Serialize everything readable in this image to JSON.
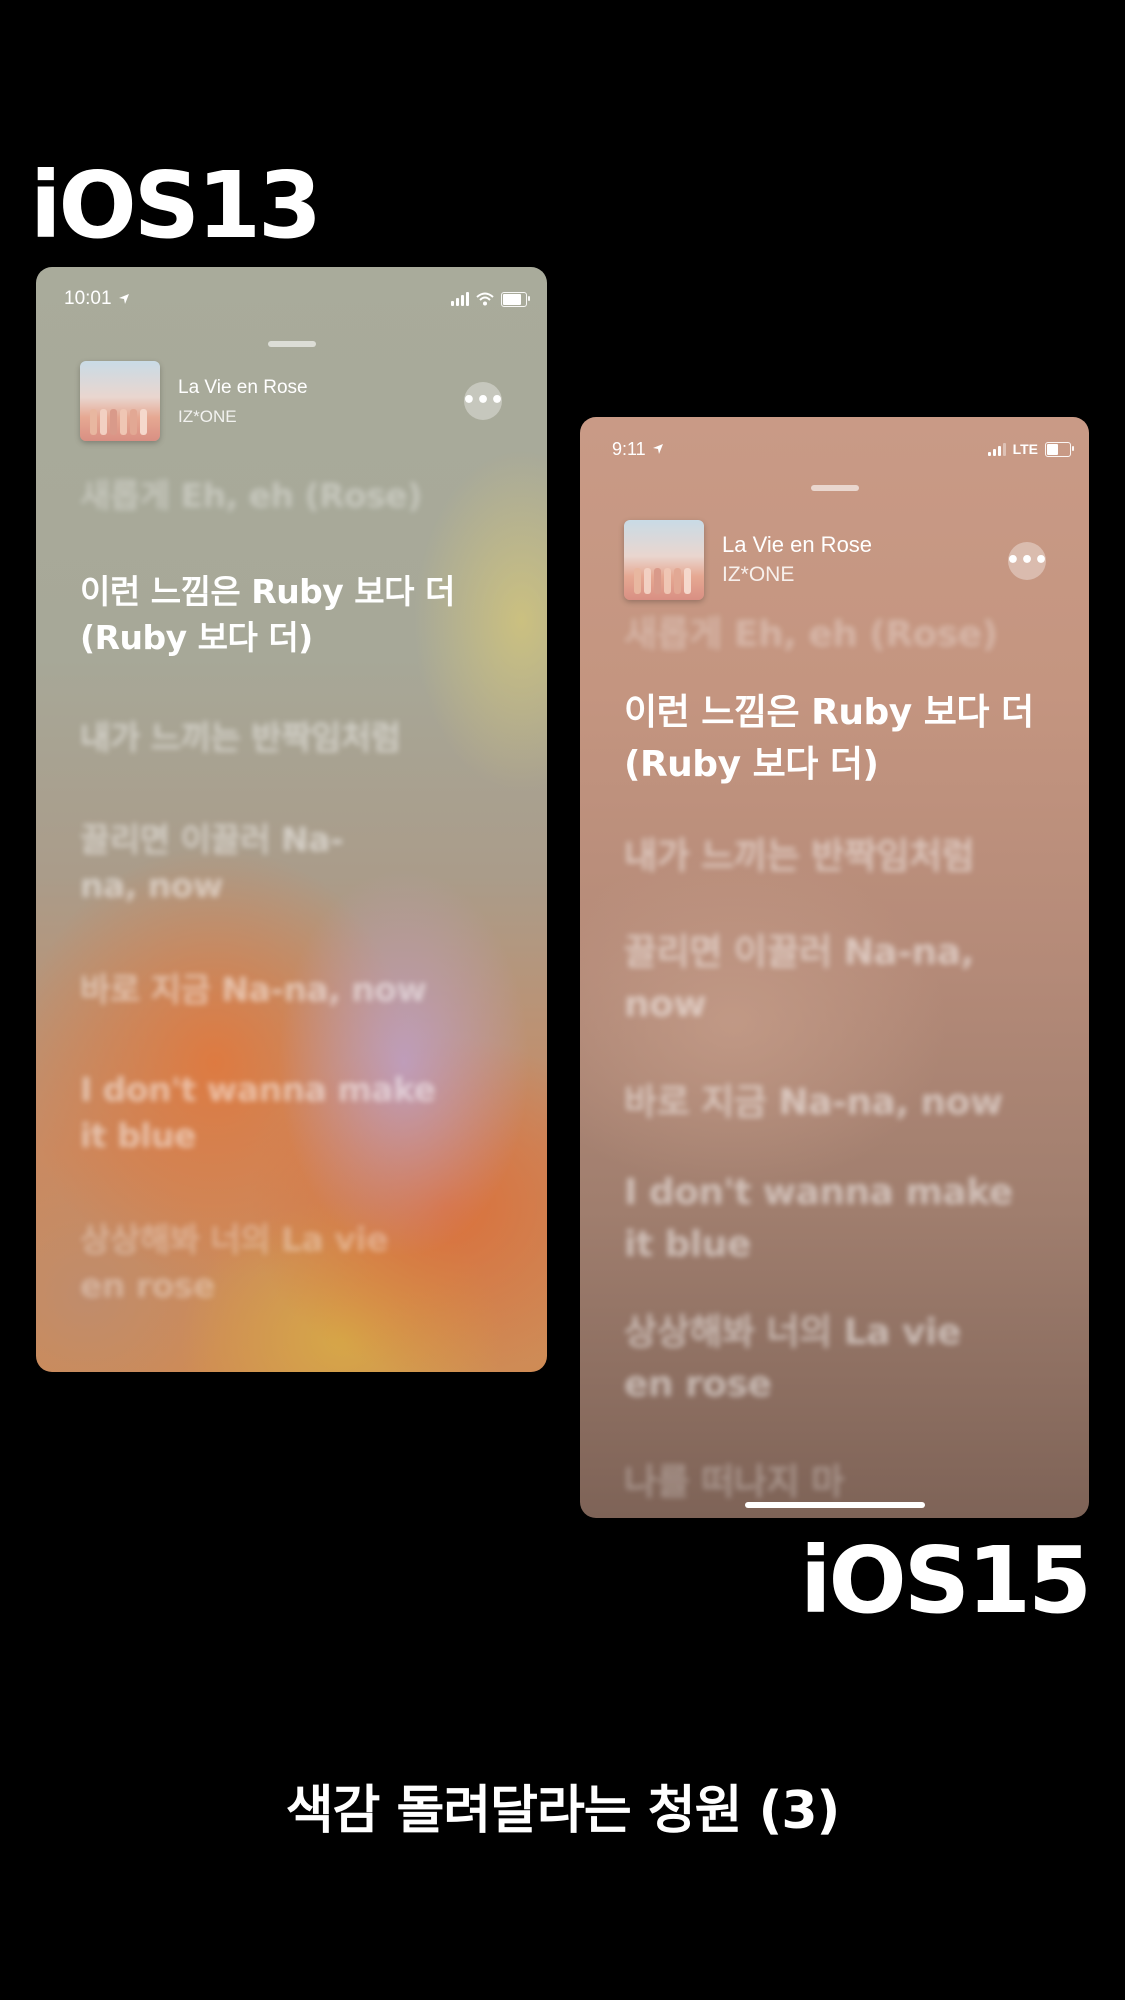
{
  "labels": {
    "left": "iOS13",
    "right": "iOS15",
    "caption": "색감 돌려달라는 청원 (3)"
  },
  "ios13": {
    "status": {
      "time": "10:01",
      "location_icon": "location-arrow-icon",
      "signal_icon": "signal-bars-icon",
      "wifi_icon": "wifi-icon",
      "battery_icon": "battery-icon",
      "battery_level": 0.8
    },
    "track": {
      "title": "La Vie en Rose",
      "artist": "IZ*ONE",
      "more_icon": "ellipsis-icon"
    },
    "lyrics": [
      "새롭게 Eh, eh (Rose)",
      "이런 느낌은 Ruby 보다 더 (Ruby 보다 더)",
      "내가 느끼는 반짝임처럼",
      "끌리면 이끌러 Na-na, now",
      "바로 지금 Na-na, now",
      "I don't wanna make it blue",
      "상상해봐 너의 La vie en rose"
    ],
    "current_index": 1
  },
  "ios15": {
    "status": {
      "time": "9:11",
      "network": "LTE",
      "location_icon": "location-arrow-icon",
      "signal_icon": "signal-bars-icon",
      "battery_icon": "battery-icon",
      "battery_level": 0.5
    },
    "track": {
      "title": "La Vie en Rose",
      "artist": "IZ*ONE",
      "more_icon": "ellipsis-icon"
    },
    "lyrics": [
      "새롭게 Eh, eh (Rose)",
      "이런 느낌은 Ruby 보다 더 (Ruby 보다 더)",
      "내가 느끼는 반짝임처럼",
      "끌리면 이끌러 Na-na, now",
      "바로 지금 Na-na, now",
      "I don't wanna make it blue",
      "상상해봐 너의 La vie en rose",
      "나를 떠나지 마"
    ],
    "current_index": 1
  },
  "colors": {
    "background": "#000000",
    "ios13_bg_accent": "#cf8b55",
    "ios15_bg_accent": "#c99a86"
  }
}
